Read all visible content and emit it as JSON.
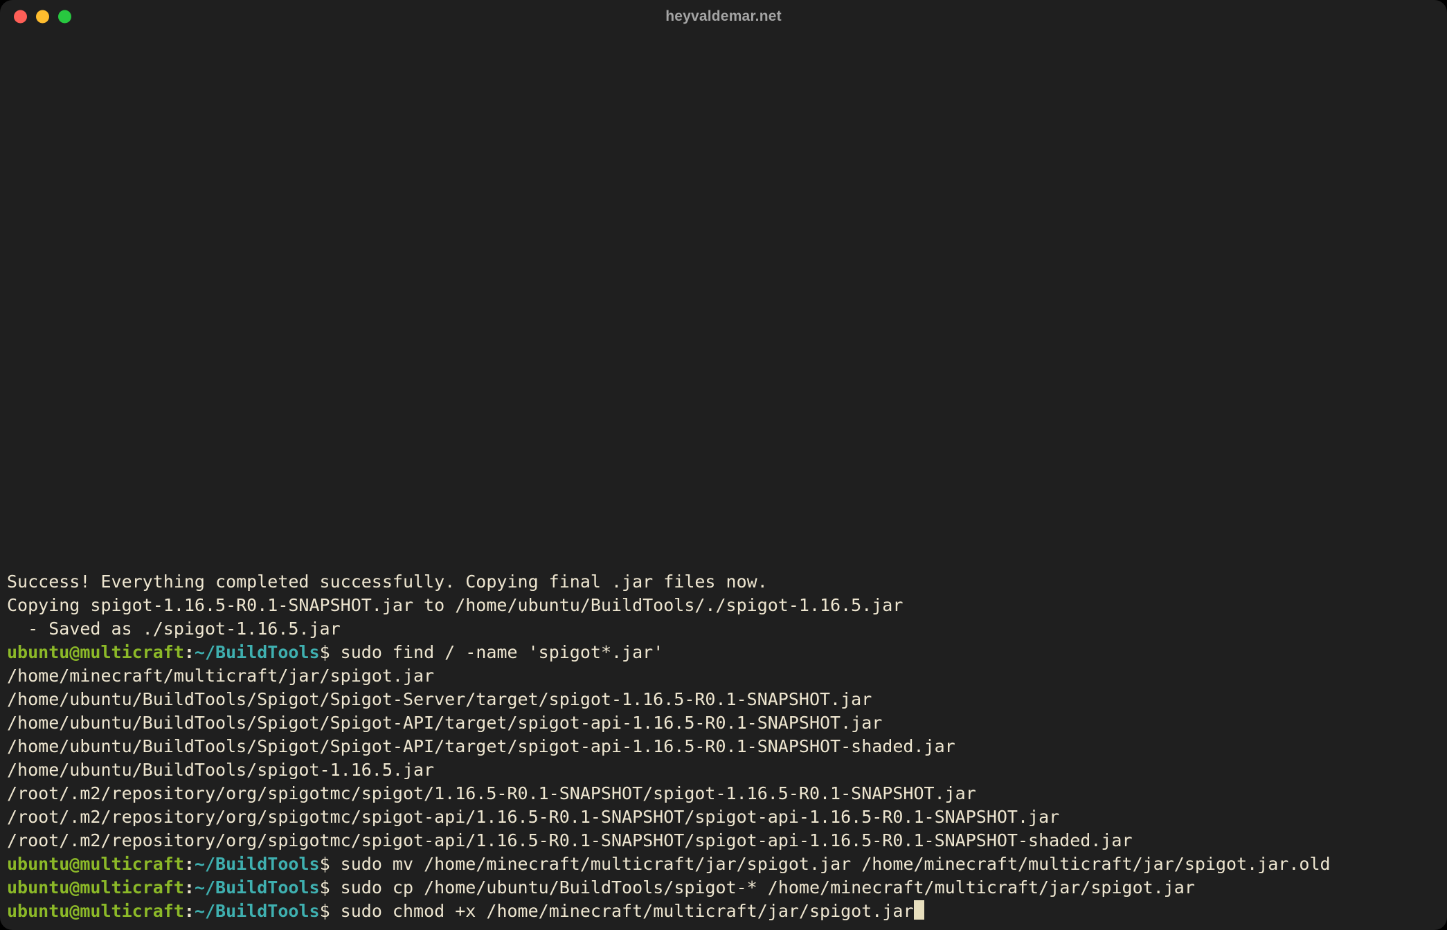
{
  "window": {
    "title": "heyvaldemar.net"
  },
  "prompt": {
    "user_host": "ubuntu@multicraft",
    "colon": ":",
    "path": "~/BuildTools",
    "dollar": "$ "
  },
  "lines": [
    {
      "t": "out",
      "text": "Success! Everything completed successfully. Copying final .jar files now."
    },
    {
      "t": "out",
      "text": "Copying spigot-1.16.5-R0.1-SNAPSHOT.jar to /home/ubuntu/BuildTools/./spigot-1.16.5.jar"
    },
    {
      "t": "out",
      "text": "  - Saved as ./spigot-1.16.5.jar"
    },
    {
      "t": "prompt",
      "cmd": "sudo find / -name 'spigot*.jar'"
    },
    {
      "t": "out",
      "text": "/home/minecraft/multicraft/jar/spigot.jar"
    },
    {
      "t": "out",
      "text": "/home/ubuntu/BuildTools/Spigot/Spigot-Server/target/spigot-1.16.5-R0.1-SNAPSHOT.jar"
    },
    {
      "t": "out",
      "text": "/home/ubuntu/BuildTools/Spigot/Spigot-API/target/spigot-api-1.16.5-R0.1-SNAPSHOT.jar"
    },
    {
      "t": "out",
      "text": "/home/ubuntu/BuildTools/Spigot/Spigot-API/target/spigot-api-1.16.5-R0.1-SNAPSHOT-shaded.jar"
    },
    {
      "t": "out",
      "text": "/home/ubuntu/BuildTools/spigot-1.16.5.jar"
    },
    {
      "t": "out",
      "text": "/root/.m2/repository/org/spigotmc/spigot/1.16.5-R0.1-SNAPSHOT/spigot-1.16.5-R0.1-SNAPSHOT.jar"
    },
    {
      "t": "out",
      "text": "/root/.m2/repository/org/spigotmc/spigot-api/1.16.5-R0.1-SNAPSHOT/spigot-api-1.16.5-R0.1-SNAPSHOT.jar"
    },
    {
      "t": "out",
      "text": "/root/.m2/repository/org/spigotmc/spigot-api/1.16.5-R0.1-SNAPSHOT/spigot-api-1.16.5-R0.1-SNAPSHOT-shaded.jar"
    },
    {
      "t": "prompt",
      "cmd": "sudo mv /home/minecraft/multicraft/jar/spigot.jar /home/minecraft/multicraft/jar/spigot.jar.old"
    },
    {
      "t": "prompt",
      "cmd": "sudo cp /home/ubuntu/BuildTools/spigot-* /home/minecraft/multicraft/jar/spigot.jar"
    },
    {
      "t": "prompt",
      "cmd": "sudo chmod +x /home/minecraft/multicraft/jar/spigot.jar",
      "cursor": true
    }
  ]
}
